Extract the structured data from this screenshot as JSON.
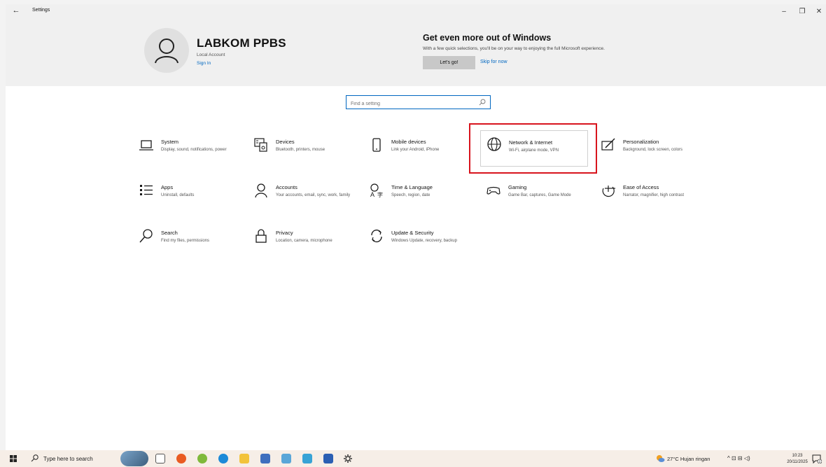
{
  "window": {
    "title": "Settings",
    "minimize_symbol": "–",
    "maximize_symbol": "❐",
    "close_symbol": "✕",
    "back_symbol": "←"
  },
  "account": {
    "name": "LABKOM PPBS",
    "type": "Local Account",
    "sign_in_label": "Sign In"
  },
  "promo": {
    "title": "Get even more out of Windows",
    "text": "With a few quick selections, you'll be on your way to enjoying the full Microsoft experience.",
    "go_label": "Let's go!",
    "skip_label": "Skip for now"
  },
  "search": {
    "placeholder": "Find a setting"
  },
  "tiles": [
    {
      "icon": "laptop-icon",
      "title": "System",
      "desc": "Display, sound, notifications, power"
    },
    {
      "icon": "keyboard-icon",
      "title": "Devices",
      "desc": "Bluetooth, printers, mouse"
    },
    {
      "icon": "phone-icon",
      "title": "Mobile devices",
      "desc": "Link your Android, iPhone"
    },
    {
      "icon": "globe-icon",
      "title": "Network & Internet",
      "desc": "Wi-Fi, airplane mode, VPN"
    },
    {
      "icon": "paint-icon",
      "title": "Personalization",
      "desc": "Background, lock screen, colors"
    },
    {
      "icon": "apps-list-icon",
      "title": "Apps",
      "desc": "Uninstall, defaults"
    },
    {
      "icon": "person-icon",
      "title": "Accounts",
      "desc": "Your accounts, email, sync, work, family"
    },
    {
      "icon": "language-icon",
      "title": "Time & Language",
      "desc": "Speech, region, date"
    },
    {
      "icon": "gamepad-icon",
      "title": "Gaming",
      "desc": "Game Bar, captures, Game Mode"
    },
    {
      "icon": "accessibility-icon",
      "title": "Ease of Access",
      "desc": "Narrator, magnifier, high contrast"
    },
    {
      "icon": "search-icon",
      "title": "Search",
      "desc": "Find my files, permissions"
    },
    {
      "icon": "lock-icon",
      "title": "Privacy",
      "desc": "Location, camera, microphone"
    },
    {
      "icon": "sync-icon",
      "title": "Update & Security",
      "desc": "Windows Update, recovery, backup"
    }
  ],
  "highlighted_tile": "Network & Internet",
  "taskbar": {
    "search_placeholder": "Type here to search",
    "weather": "27°C  Hujan ringan",
    "tray": "^  ⊡  ⊟  ◁)",
    "time": "10:23",
    "date": "20/11/2025",
    "notification_count": "2"
  },
  "colors": {
    "accent": "#0067c0",
    "highlight_border": "#d8141d",
    "header_bg": "#f0f0f0",
    "taskbar_bg": "#f6eee7"
  }
}
